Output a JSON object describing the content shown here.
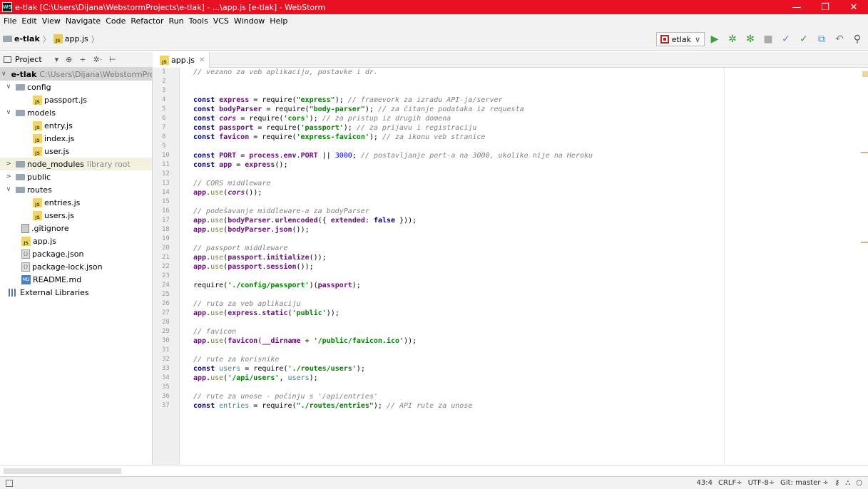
{
  "window": {
    "title": "e-tlak [C:\\Users\\Dijana\\WebstormProjects\\e-tlak] - ...\\app.js [e-tlak] - WebStorm",
    "minimize": "—",
    "maximize": "❐",
    "close": "✕"
  },
  "menu": [
    "File",
    "Edit",
    "View",
    "Navigate",
    "Code",
    "Refactor",
    "Run",
    "Tools",
    "VCS",
    "Window",
    "Help"
  ],
  "breadcrumb": {
    "project": "e-tlak",
    "file": "app.js"
  },
  "run_config": {
    "label": "etlak"
  },
  "project_panel": {
    "label": "Project"
  },
  "tree": {
    "root_label": "e-tlak",
    "root_path": "C:\\Users\\Dijana\\WebstormPro",
    "config": "config",
    "passport": "passport.js",
    "models": "models",
    "entry": "entry.js",
    "index": "index.js",
    "user": "user.js",
    "node_modules": "node_modules",
    "node_modules_note": "library root",
    "public": "public",
    "routes": "routes",
    "entries": "entries.js",
    "users": "users.js",
    "gitignore": ".gitignore",
    "appjs": "app.js",
    "package": "package.json",
    "package_lock": "package-lock.json",
    "readme": "README.md",
    "external": "External Libraries"
  },
  "tab": {
    "label": "app.js"
  },
  "line_numbers": [
    "1",
    "2",
    "3",
    "4",
    "5",
    "6",
    "7",
    "8",
    "9",
    "10",
    "11",
    "12",
    "13",
    "14",
    "15",
    "16",
    "17",
    "18",
    "19",
    "20",
    "21",
    "22",
    "23",
    "24",
    "25",
    "26",
    "27",
    "28",
    "29",
    "30",
    "31",
    "32",
    "33",
    "34",
    "35",
    "36",
    "37"
  ],
  "code": {
    "l1": "// vezano za veb aplikaciju, postavke i dr.",
    "l4c": "// framevork za izradu API-ja/server",
    "l5c": "// za čitanje podataka iz requesta",
    "l6c": "// za pristup iz drugih domena",
    "l7c": "// za prijavu i registraciju",
    "l8c": "// za ikonu veb stranice",
    "l10c": "// postavljanje port-a na 3000, ukoliko nije na Heroku",
    "l13": "// CORS middleware",
    "l16": "// podešavanje middleware-a za bodyParser",
    "l20": "// passport middleware",
    "l26": "// ruta za veb aplikaciju",
    "l29": "// favicon",
    "l32": "// rute za korisnike",
    "l36": "// rute za unose - počinju s '/api/entries'",
    "l37c": "// API rute za unose"
  },
  "status": {
    "position": "43:4",
    "line_sep": "CRLF÷",
    "encoding": "UTF-8÷",
    "git": "Git: master ÷"
  }
}
